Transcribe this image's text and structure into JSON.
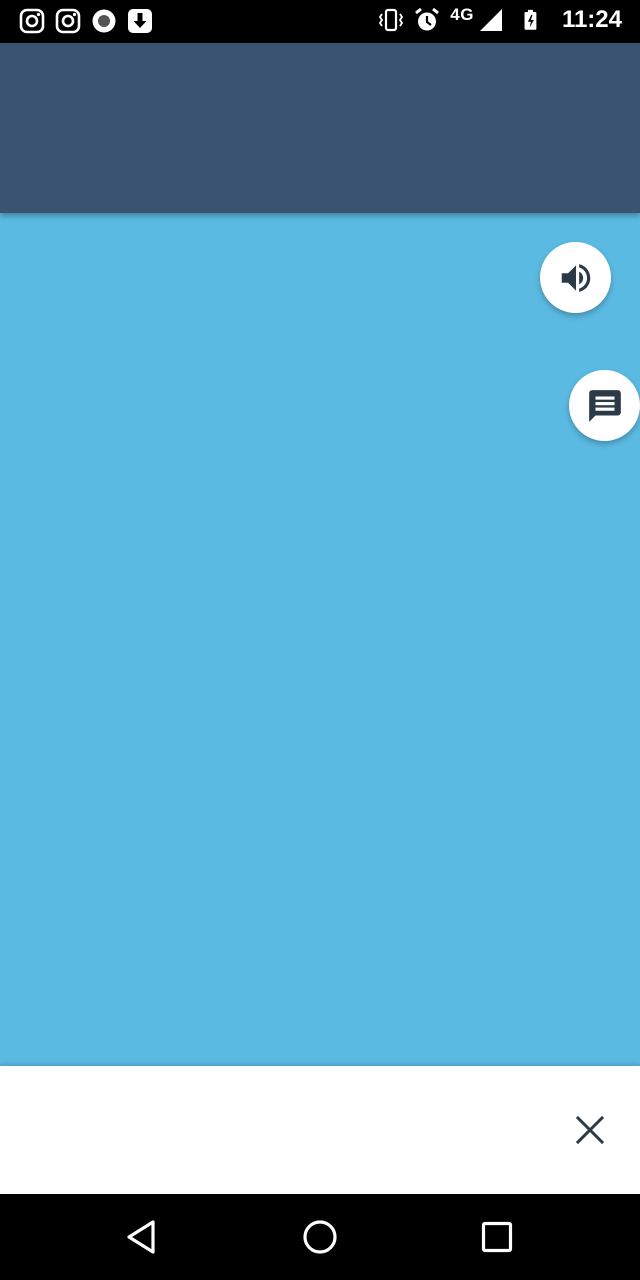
{
  "status_bar": {
    "notification_icons": [
      "instagram-icon",
      "instagram-icon",
      "record-icon",
      "download-icon"
    ],
    "system_icons": [
      "vibrate-icon",
      "alarm-icon",
      "signal-icon",
      "battery-charging-icon"
    ],
    "network": "4G",
    "time": "11:24"
  },
  "colors": {
    "header": "#3a5370",
    "content": "#5bbae2",
    "banner": "#ffffff",
    "icon_dark": "#2c3a48"
  },
  "floating_buttons": [
    "volume-icon",
    "chat-icon"
  ],
  "banner": {
    "close_icon": "close-icon"
  },
  "nav_bar": [
    "back-icon",
    "home-icon",
    "recents-icon"
  ]
}
